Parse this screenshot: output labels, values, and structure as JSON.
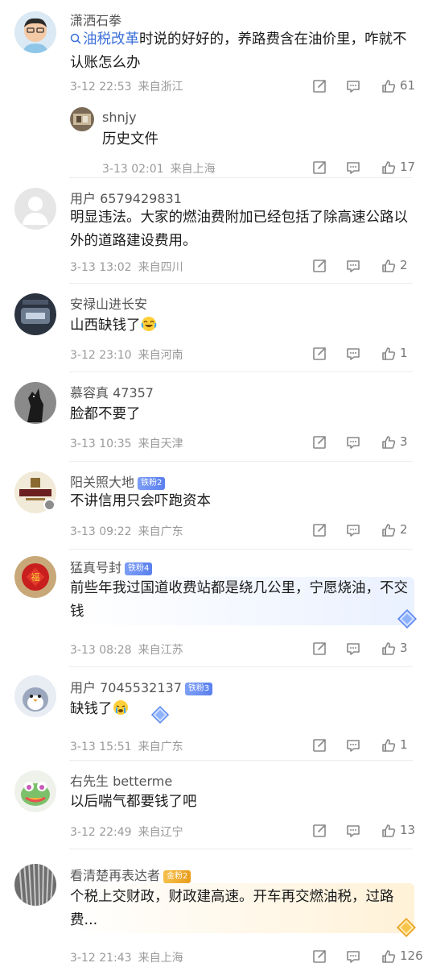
{
  "comments": [
    {
      "name": "潇洒石拳",
      "search_link": "油税改革",
      "text_rest": "时说的好好的，养路费含在油价里，咋就不认账怎么办",
      "time": "3-12 22:53",
      "location": "来自浙江",
      "likes": "61",
      "reply": {
        "name": "shnjy",
        "text": "历史文件",
        "time": "3-13 02:01",
        "location": "来自上海",
        "likes": "17"
      }
    },
    {
      "name": "用户 6579429831",
      "text": "明显违法。大家的燃油费附加已经包括了除高速公路以外的道路建设费用。",
      "time": "3-13 13:02",
      "location": "来自四川",
      "likes": "2"
    },
    {
      "name": "安禄山进长安",
      "text": "山西缺钱了",
      "time": "3-12 23:10",
      "location": "来自河南",
      "likes": "1"
    },
    {
      "name": "慕容真 47357",
      "text": "脸都不要了",
      "time": "3-13 10:35",
      "location": "来自天津",
      "likes": "3"
    },
    {
      "name": "阳关照大地",
      "badge": "铁粉2",
      "text": "不讲信用只会吓跑资本",
      "time": "3-13 09:22",
      "location": "来自广东",
      "likes": "2"
    },
    {
      "name": "猛真号封",
      "badge": "铁粉4",
      "text": "前些年我过国道收费站都是绕几公里，宁愿烧油，不交钱",
      "time": "3-13 08:28",
      "location": "来自江苏",
      "likes": "3"
    },
    {
      "name": "用户 7045532137",
      "badge": "铁粉3",
      "text": "缺钱了",
      "time": "3-13 15:51",
      "location": "来自广东",
      "likes": "1"
    },
    {
      "name": "右先生 betterme",
      "text": "以后喘气都要钱了吧",
      "time": "3-12 22:49",
      "location": "来自辽宁",
      "likes": "13"
    },
    {
      "name": "看清楚再表达者",
      "badge": "金粉2",
      "text": "个税上交财政，财政建高速。开车再交燃油税，过路费...",
      "time": "3-12 21:43",
      "location": "来自上海",
      "likes": "126"
    }
  ],
  "icons": {
    "share": "share-icon",
    "comment": "comment-icon",
    "like": "thumbs-up-icon",
    "search": "search-icon"
  },
  "colors": {
    "link": "#3b6fd8",
    "badge_iron": "#6a8ff0",
    "badge_gold": "#eca52a",
    "meta_text": "#9a9a9a"
  }
}
